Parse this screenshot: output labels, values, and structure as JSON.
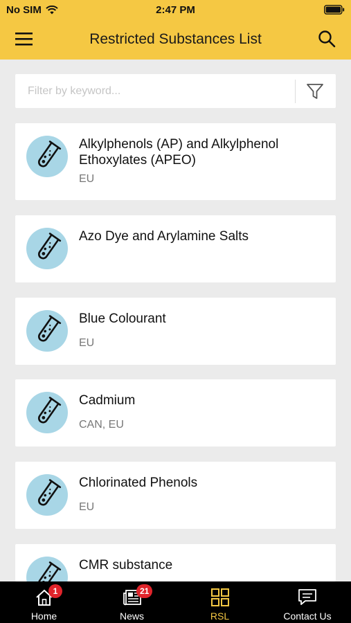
{
  "status_bar": {
    "carrier": "No SIM",
    "time": "2:47 PM"
  },
  "header": {
    "title": "Restricted Substances List",
    "menu_icon": "hamburger-menu-icon",
    "search_icon": "search-icon"
  },
  "filter": {
    "placeholder": "Filter by keyword...",
    "value": "",
    "filter_icon": "funnel-filter-icon"
  },
  "colors": {
    "accent": "#f5c843",
    "avatar_bg": "#a8d6e6",
    "badge": "#e0242b"
  },
  "substances": [
    {
      "name": "Alkylphenols (AP) and Alkylphenol Ethoxylates (APEO)",
      "region": "EU"
    },
    {
      "name": "Azo Dye and Arylamine Salts",
      "region": ""
    },
    {
      "name": "Blue Colourant",
      "region": "EU"
    },
    {
      "name": "Cadmium",
      "region": "CAN, EU"
    },
    {
      "name": "Chlorinated Phenols",
      "region": "EU"
    },
    {
      "name": "CMR substance",
      "region": ""
    }
  ],
  "tabs": [
    {
      "label": "Home",
      "icon": "home-icon",
      "badge": "1",
      "active": false
    },
    {
      "label": "News",
      "icon": "newspaper-icon",
      "badge": "21",
      "active": false
    },
    {
      "label": "RSL",
      "icon": "grid-icon",
      "badge": "",
      "active": true
    },
    {
      "label": "Contact Us",
      "icon": "chat-icon",
      "badge": "",
      "active": false
    }
  ]
}
